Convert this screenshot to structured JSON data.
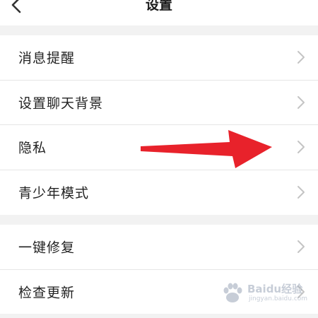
{
  "header": {
    "title": "设置",
    "back_icon": "chevron-left-icon"
  },
  "groups": [
    {
      "items": [
        {
          "label": "消息提醒"
        },
        {
          "label": "设置聊天背景"
        },
        {
          "label": "隐私"
        },
        {
          "label": "青少年模式"
        }
      ]
    },
    {
      "items": [
        {
          "label": "一键修复"
        },
        {
          "label": "检查更新"
        }
      ]
    }
  ],
  "colors": {
    "background": "#f2f2f2",
    "row": "#ffffff",
    "chevron": "#c4c4c4",
    "annotation_arrow": "#e8222b"
  },
  "watermark": {
    "text": "Baidu经验",
    "sub": "jingyan.baidu.com"
  }
}
